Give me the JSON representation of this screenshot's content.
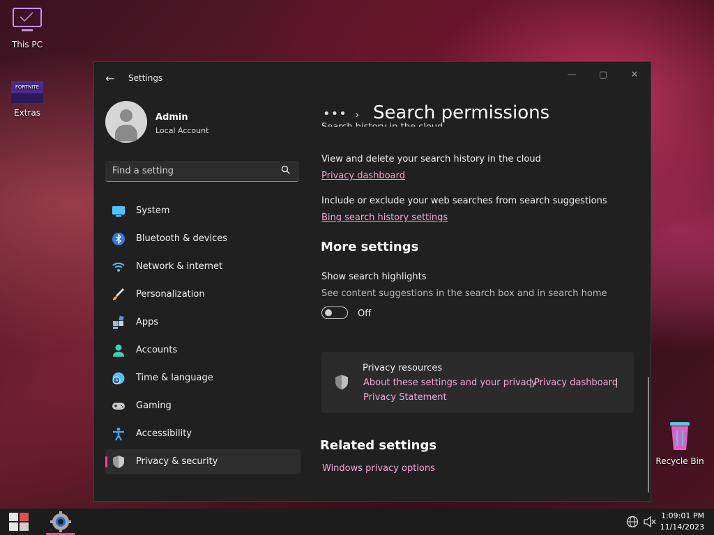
{
  "desktop": {
    "icons": [
      {
        "label": "This PC"
      },
      {
        "label": "Extras"
      },
      {
        "label": "Recycle Bin"
      }
    ]
  },
  "window": {
    "title": "Settings",
    "controls": {
      "minimize": "—",
      "maximize": "▢",
      "close": "✕"
    }
  },
  "profile": {
    "name": "Admin",
    "account_type": "Local Account"
  },
  "search": {
    "placeholder": "Find a setting"
  },
  "nav": {
    "items": [
      {
        "label": "System",
        "icon": "system-icon",
        "color": "#4cc2ff"
      },
      {
        "label": "Bluetooth & devices",
        "icon": "bluetooth-icon",
        "color": "#2f7fe0"
      },
      {
        "label": "Network & internet",
        "icon": "wifi-icon",
        "color": "#4cc2ff"
      },
      {
        "label": "Personalization",
        "icon": "brush-icon",
        "color": "#e8a86b"
      },
      {
        "label": "Apps",
        "icon": "apps-icon",
        "color": "#9fb7d6"
      },
      {
        "label": "Accounts",
        "icon": "accounts-icon",
        "color": "#3dd3b0"
      },
      {
        "label": "Time & language",
        "icon": "clock-globe-icon",
        "color": "#4cc2ff"
      },
      {
        "label": "Gaming",
        "icon": "controller-icon",
        "color": "#c8c8c8"
      },
      {
        "label": "Accessibility",
        "icon": "accessibility-icon",
        "color": "#3da9ff"
      },
      {
        "label": "Privacy & security",
        "icon": "shield-icon",
        "color": "#b8b8b8",
        "active": true
      }
    ]
  },
  "content": {
    "breadcrumb_more": "•••",
    "breadcrumb_sep": "›",
    "title": "Search permissions",
    "clipped_heading": "Search history in the cloud",
    "history": {
      "description": "View and delete your search history in the cloud",
      "link": "Privacy dashboard"
    },
    "bing": {
      "description": "Include or exclude your web searches from search suggestions",
      "link": "Bing search history settings"
    },
    "more_settings": {
      "heading": "More settings",
      "highlights_title": "Show search highlights",
      "highlights_desc": "See content suggestions in the search box and in search home",
      "toggle_state": "Off"
    },
    "privacy_resources": {
      "title": "Privacy resources",
      "link1": "About these settings and your privacy",
      "sep1": "|",
      "link2": "Privacy dashboard",
      "sep2": "|",
      "link3": "Privacy Statement"
    },
    "related": {
      "heading": "Related settings",
      "link": "Windows privacy options"
    }
  },
  "taskbar": {
    "time": "1:09:01 PM",
    "date": "11/14/2023",
    "accent": "#e24a9c"
  }
}
